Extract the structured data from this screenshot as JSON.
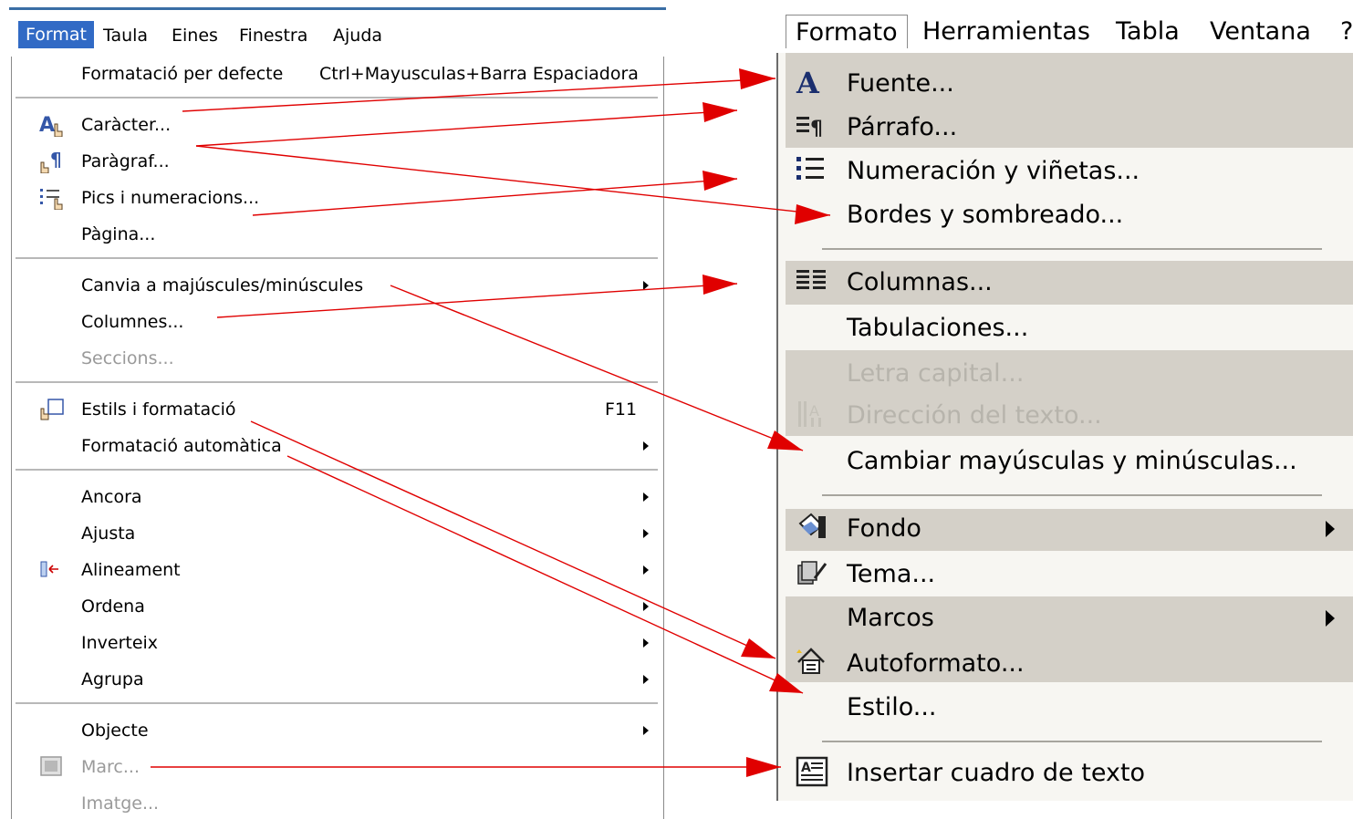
{
  "left_menu": {
    "menubar": [
      "Format",
      "Taula",
      "Eines",
      "Finestra",
      "Ajuda"
    ],
    "items": {
      "default_format": "Formatació per defecte",
      "default_format_shortcut": "Ctrl+Mayusculas+Barra Espaciadora",
      "character": "Caràcter...",
      "paragraph": "Paràgraf...",
      "bullets": "Pics i numeracions...",
      "page": "Pàgina...",
      "change_case": "Canvia a majúscules/minúscules",
      "columns": "Columnes...",
      "sections": "Seccions...",
      "styles": "Estils i formatació",
      "styles_shortcut": "F11",
      "autoformat": "Formatació automàtica",
      "anchor": "Ancora",
      "wrap": "Ajusta",
      "alignment": "Alineament",
      "arrange": "Ordena",
      "flip": "Inverteix",
      "group": "Agrupa",
      "object": "Objecte",
      "frame": "Marc...",
      "image": "Imatge..."
    }
  },
  "right_menu": {
    "menubar": [
      "Formato",
      "Herramientas",
      "Tabla",
      "Ventana",
      "?"
    ],
    "items": {
      "font": "Fuente...",
      "paragraph": "Párrafo...",
      "bullets": "Numeración y viñetas...",
      "borders": "Bordes y sombreado...",
      "columns": "Columnas...",
      "tabs": "Tabulaciones...",
      "drop_cap": "Letra capital...",
      "text_direction": "Dirección del texto...",
      "change_case": "Cambiar mayúsculas y minúsculas...",
      "background": "Fondo",
      "theme": "Tema...",
      "frames": "Marcos",
      "autoformat": "Autoformato...",
      "style": "Estilo...",
      "text_box": "Insertar cuadro de texto"
    }
  },
  "colors": {
    "arrow": "#e00000",
    "left_highlight": "#316ac5",
    "right_stripe": "#d4d0c8",
    "disabled_left": "#9a9a9a",
    "disabled_right": "#b7b4ac"
  },
  "icons": {
    "character": "font-character-icon",
    "paragraph": "paragraph-icon",
    "bullets": "bullets-numbering-icon",
    "styles": "styles-formatting-icon",
    "alignment": "alignment-icon",
    "frame": "frame-icon",
    "font": "font-a-icon",
    "right_paragraph": "paragraph-icon",
    "right_bullets": "bullets-list-icon",
    "right_columns": "columns-icon",
    "text_direction": "text-direction-icon",
    "background": "background-fill-icon",
    "theme": "theme-icon",
    "autoformat": "autoformat-icon",
    "text_box": "text-box-icon"
  }
}
